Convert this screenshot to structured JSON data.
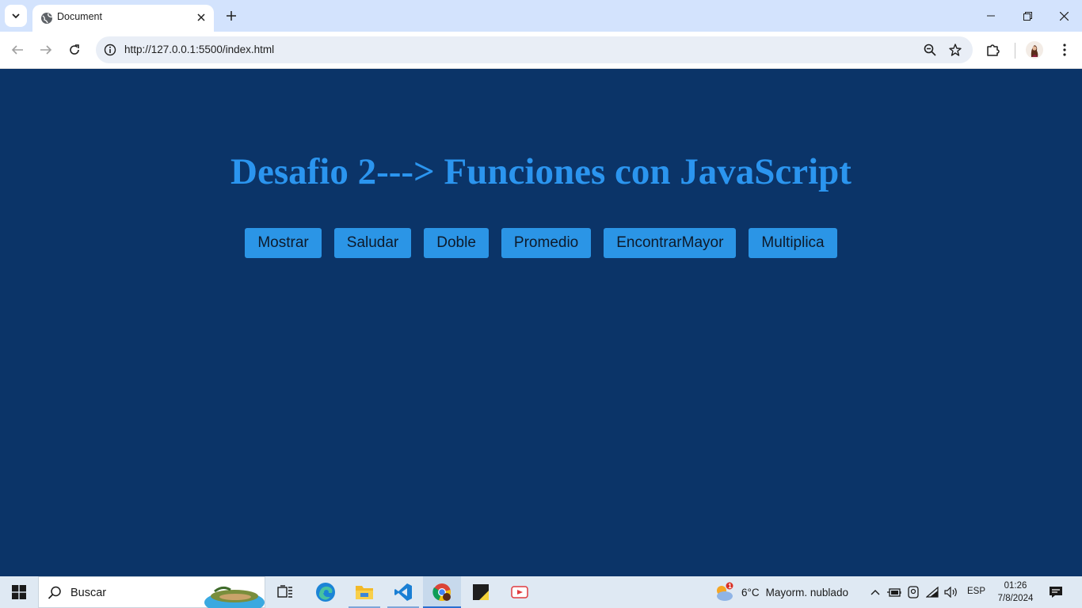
{
  "browser": {
    "tab_title": "Document",
    "url": "http://127.0.0.1:5500/index.html"
  },
  "page": {
    "title": "Desafio 2---> Funciones con JavaScript",
    "buttons": [
      {
        "label": "Mostrar"
      },
      {
        "label": "Saludar"
      },
      {
        "label": "Doble"
      },
      {
        "label": "Promedio"
      },
      {
        "label": "EncontrarMayor"
      },
      {
        "label": "Multiplica"
      }
    ],
    "colors": {
      "background": "#0b3468",
      "title": "#2b95ef",
      "button": "#2b95e6"
    }
  },
  "taskbar": {
    "search_placeholder": "Buscar",
    "weather": {
      "temperature": "6°C",
      "condition": "Mayorm. nublado",
      "badge": "1"
    },
    "language": "ESP",
    "time": "01:26",
    "date": "7/8/2024",
    "apps": [
      "task-view",
      "edge",
      "file-explorer",
      "vscode",
      "chrome",
      "sticky-notes",
      "video-app"
    ]
  }
}
